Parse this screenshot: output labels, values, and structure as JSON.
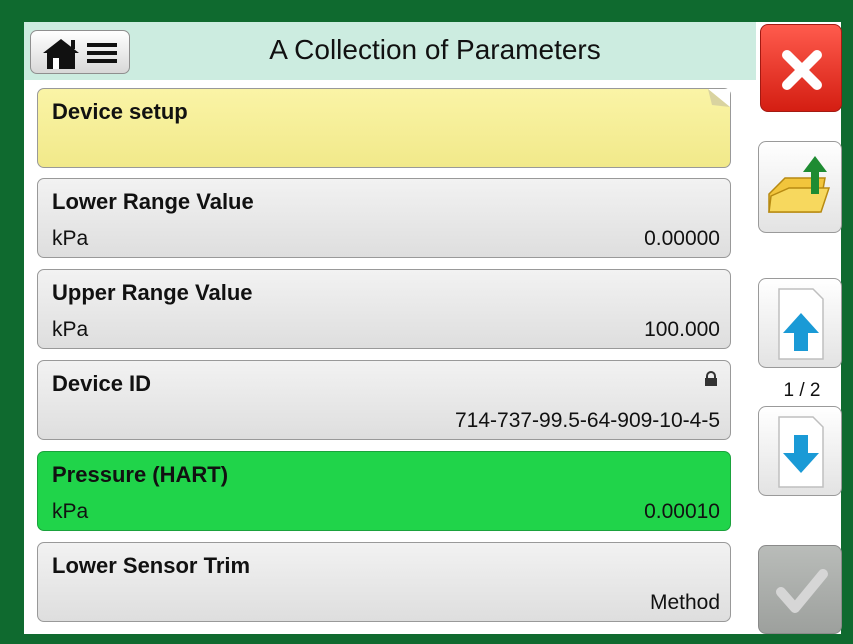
{
  "header": {
    "title": "A Collection of Parameters"
  },
  "parameters": [
    {
      "title": "Device setup",
      "unit": "",
      "value": "",
      "style": "note"
    },
    {
      "title": "Lower Range Value",
      "unit": "kPa",
      "value": "0.00000",
      "style": "normal"
    },
    {
      "title": "Upper Range Value",
      "unit": "kPa",
      "value": "100.000",
      "style": "normal"
    },
    {
      "title": "Device ID",
      "unit": "",
      "value": "714-737-99.5-64-909-10-4-5",
      "style": "locked"
    },
    {
      "title": "Pressure (HART)",
      "unit": "kPa",
      "value": "0.00010",
      "style": "highlight"
    },
    {
      "title": "Lower Sensor Trim",
      "unit": "",
      "value": "Method",
      "style": "normal"
    }
  ],
  "pager": {
    "indicator": "1 / 2"
  },
  "icons": {
    "home": "home-icon",
    "menu": "hamburger-menu-icon",
    "close": "close-x-icon",
    "open_folder": "folder-arrow-up-icon",
    "page_up": "page-up-arrow-icon",
    "page_down": "page-down-arrow-icon",
    "ok": "checkmark-icon",
    "lock": "lock-icon",
    "note_corner": "folded-corner-icon"
  },
  "colors": {
    "frame": "#0f6a2f",
    "header": "#ccece0",
    "note_panel": "#f3eb91",
    "highlight_panel": "#20d44a",
    "close_button": "#e42c1f",
    "arrow": "#1a9ad6",
    "folder_arrow": "#1e8b32"
  }
}
